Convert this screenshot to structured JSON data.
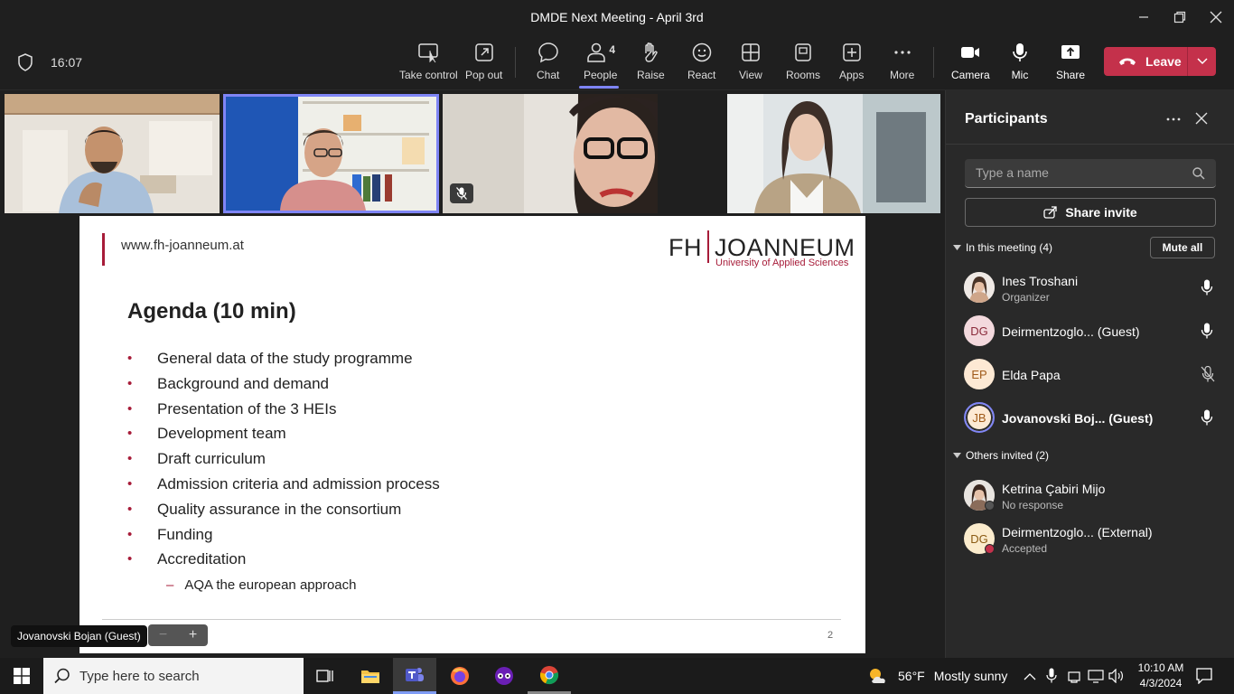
{
  "window": {
    "title": "DMDE Next Meeting - April 3rd"
  },
  "toolbar": {
    "timer": "16:07",
    "people_count": "4",
    "buttons": {
      "take_control": "Take control",
      "pop_out": "Pop out",
      "chat": "Chat",
      "people": "People",
      "raise": "Raise",
      "react": "React",
      "view": "View",
      "rooms": "Rooms",
      "apps": "Apps",
      "more": "More",
      "camera": "Camera",
      "mic": "Mic",
      "share": "Share",
      "leave": "Leave"
    },
    "active_tab": "People",
    "leave_color": "#c4314b",
    "accent_color": "#7f85f5"
  },
  "slide": {
    "url": "www.fh-joanneum.at",
    "logo_left": "FH",
    "logo_right": "JOANNEUM",
    "logo_sub": "University of Applied Sciences",
    "heading": "Agenda (10 min)",
    "items": [
      "General data of the study programme",
      "Background and demand",
      "Presentation of the 3 HEIs",
      "Development team",
      "Draft curriculum",
      "Admission criteria and admission process",
      "Quality assurance in the consortium",
      "Funding",
      "Accreditation"
    ],
    "subitem": "AQA the european approach",
    "page_number": "2",
    "bullet": "•",
    "dash": "–",
    "brand_color": "#a71c39"
  },
  "presenter_label": "Jovanovski Bojan (Guest)",
  "zoom": {
    "minus": "−",
    "plus": "+"
  },
  "participants": {
    "title": "Participants",
    "search_placeholder": "Type a name",
    "share_invite": "Share invite",
    "in_meeting_label": "In this meeting (4)",
    "mute_all": "Mute all",
    "in_meeting": [
      {
        "name": "Ines Troshani",
        "role": "Organizer",
        "initials": "",
        "mic": "on"
      },
      {
        "name": "Deirmentzoglo... (Guest)",
        "role": "",
        "initials": "DG",
        "mic": "on"
      },
      {
        "name": "Elda Papa",
        "role": "",
        "initials": "EP",
        "mic": "muted"
      },
      {
        "name": "Jovanovski Boj... (Guest)",
        "role": "",
        "initials": "JB",
        "mic": "on"
      }
    ],
    "others_label": "Others invited (2)",
    "others": [
      {
        "name": "Ketrina Çabiri Mijo",
        "role": "No response",
        "initials": ""
      },
      {
        "name": "Deirmentzoglo... (External)",
        "role": "Accepted",
        "initials": "DG"
      }
    ]
  },
  "taskbar": {
    "search_placeholder": "Type here to search",
    "weather_temp": "56°F",
    "weather_text": "Mostly sunny",
    "time": "10:10 AM",
    "date": "4/3/2024"
  }
}
